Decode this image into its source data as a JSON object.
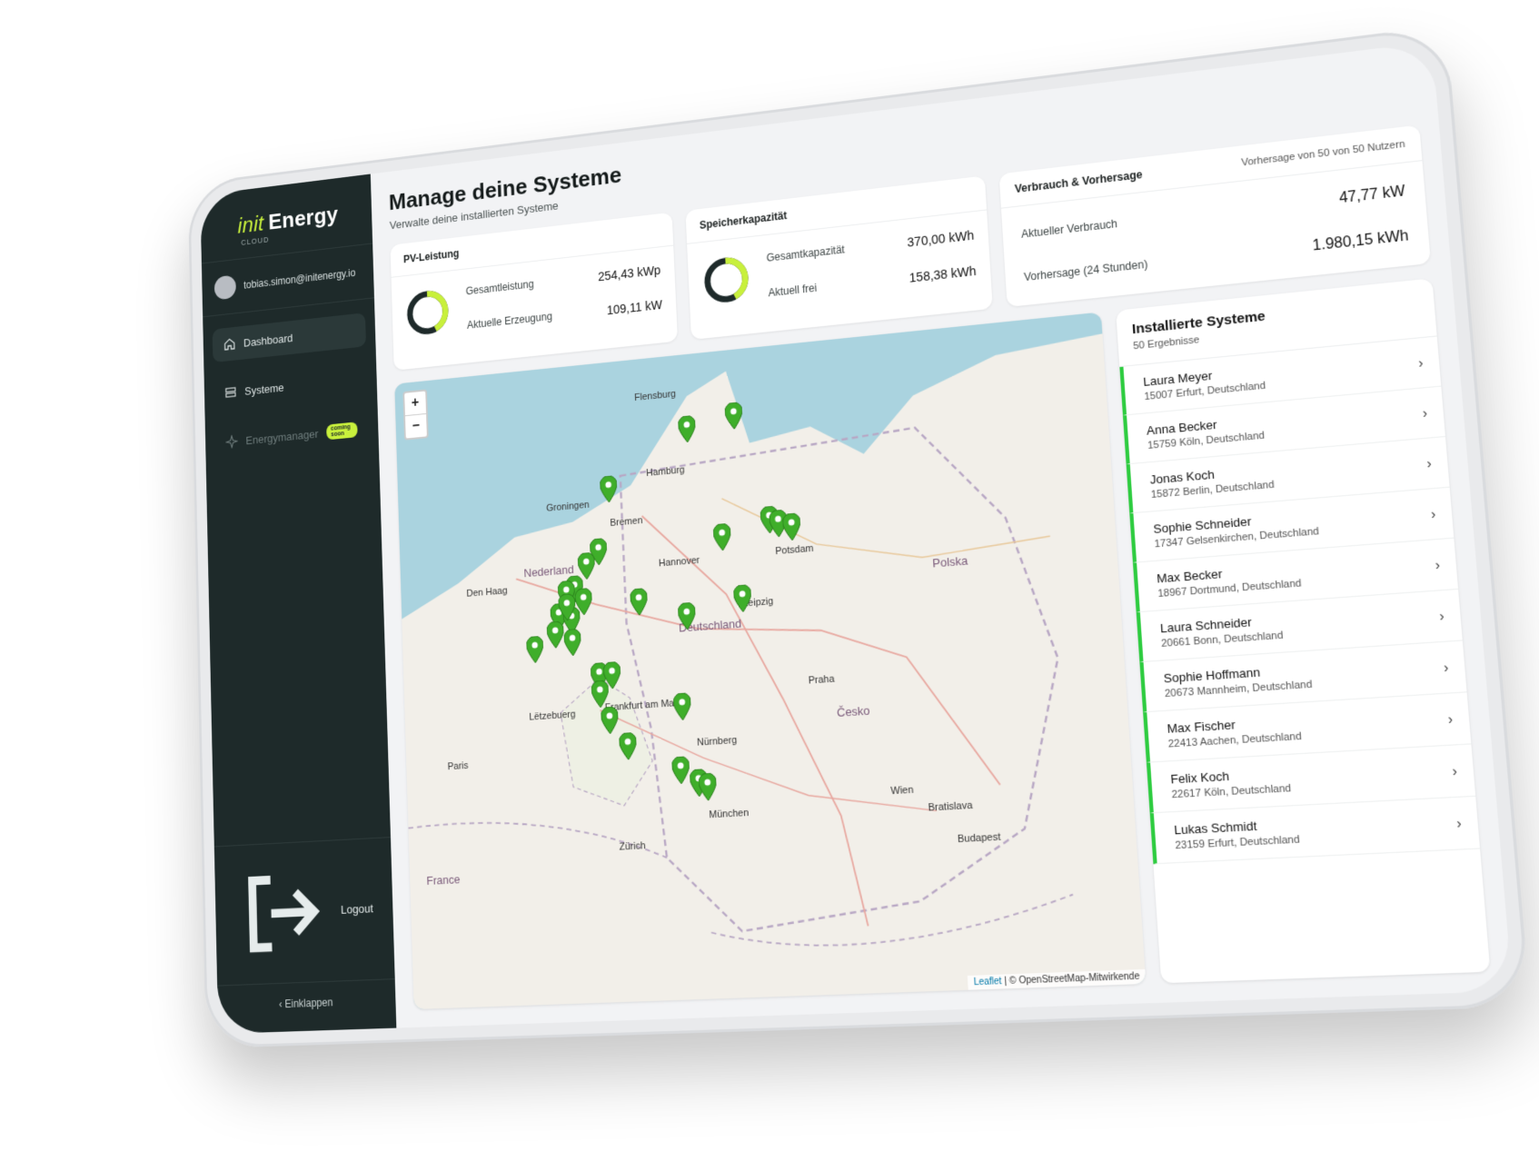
{
  "brand": {
    "init": "init",
    "energy": "Energy",
    "cloud": "CLOUD"
  },
  "user": {
    "email": "tobias.simon@initenergy.io"
  },
  "nav": {
    "dashboard": "Dashboard",
    "systeme": "Systeme",
    "energymanager": "Energymanager",
    "coming_soon": "coming soon",
    "logout": "Logout",
    "collapse": "Einklappen"
  },
  "page": {
    "title": "Manage deine Systeme",
    "subtitle": "Verwalte deine installierten Systeme"
  },
  "pv": {
    "title": "PV-Leistung",
    "k1": "Gesamtleistung",
    "v1": "254,43 kWp",
    "k2": "Aktuelle Erzeugung",
    "v2": "109,11 kW",
    "fraction": 0.43
  },
  "storage": {
    "title": "Speicherkapazität",
    "k1": "Gesamtkapazität",
    "v1": "370,00 kWh",
    "k2": "Aktuell frei",
    "v2": "158,38 kWh",
    "fraction": 0.43
  },
  "consumption": {
    "title": "Verbrauch & Vorhersage",
    "meta": "Vorhersage von 50 von 50 Nutzern",
    "k1": "Aktueller Verbrauch",
    "v1": "47,77 kW",
    "k2": "Vorhersage (24 Stunden)",
    "v2": "1.980,15 kWh"
  },
  "map": {
    "zoom_in": "+",
    "zoom_out": "−",
    "attribution_leaflet": "Leaflet",
    "attribution_osm": "| © OpenStreetMap-Mitwirkende",
    "labels": {
      "hamburg": "Hamburg",
      "bremen": "Bremen",
      "hannover": "Hannover",
      "deutschland": "Deutschland",
      "nederland": "Nederland",
      "polska": "Polska",
      "praha": "Praha",
      "cesko": "Česko",
      "nurnberg": "Nürnberg",
      "munchen": "München",
      "paris": "Paris",
      "wien": "Wien",
      "frankfurt": "Frankfurt am Main",
      "zurich": "Zürich",
      "letzebuerg": "Lëtzebuerg",
      "potsdam": "Potsdam",
      "leipzig": "Leipzig",
      "flensburg": "Flensburg",
      "groningen": "Groningen",
      "denhaag": "Den Haag",
      "bratislava": "Bratislava",
      "budapest": "Budapest",
      "france": "France"
    },
    "accent": "#3fae2a"
  },
  "systems": {
    "title": "Installierte Systeme",
    "count": "50 Ergebnisse",
    "items": [
      {
        "name": "Laura Meyer",
        "addr": "15007 Erfurt, Deutschland"
      },
      {
        "name": "Anna Becker",
        "addr": "15759 Köln, Deutschland"
      },
      {
        "name": "Jonas Koch",
        "addr": "15872 Berlin, Deutschland"
      },
      {
        "name": "Sophie Schneider",
        "addr": "17347 Gelsenkirchen, Deutschland"
      },
      {
        "name": "Max Becker",
        "addr": "18967 Dortmund, Deutschland"
      },
      {
        "name": "Laura Schneider",
        "addr": "20661 Bonn, Deutschland"
      },
      {
        "name": "Sophie Hoffmann",
        "addr": "20673 Mannheim, Deutschland"
      },
      {
        "name": "Max Fischer",
        "addr": "22413 Aachen, Deutschland"
      },
      {
        "name": "Felix Koch",
        "addr": "22617 Köln, Deutschland"
      },
      {
        "name": "Lukas Schmidt",
        "addr": "23159 Erfurt, Deutschland"
      }
    ]
  },
  "colors": {
    "sidebar": "#1e2a2a",
    "accent": "#c8f03c",
    "list_accent": "#2ecc40"
  }
}
